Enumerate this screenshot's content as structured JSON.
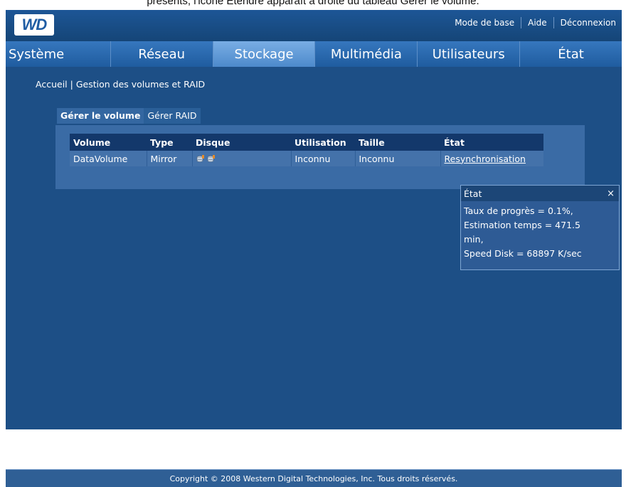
{
  "caption": "présents, l'icône Étendre apparaît à droite du tableau Gérer le volume.",
  "header": {
    "logo_text": "WD",
    "links": [
      "Mode de base",
      "Aide",
      "Déconnexion"
    ]
  },
  "nav": {
    "tabs": [
      "Système",
      "Réseau",
      "Stockage",
      "Multimédia",
      "Utilisateurs",
      "État"
    ],
    "active": "Stockage"
  },
  "breadcrumb": {
    "home": "Accueil",
    "separator": "|",
    "current": "Gestion des volumes et RAID"
  },
  "subtabs": {
    "manage_volume": "Gérer le volume",
    "manage_raid": "Gérer RAID"
  },
  "table": {
    "headers": {
      "volume": "Volume",
      "type": "Type",
      "disk": "Disque",
      "usage": "Utilisation",
      "size": "Taille",
      "status": "État"
    },
    "row": {
      "volume": "DataVolume",
      "type": "Mirror",
      "disk_icons": [
        "disk-1-icon",
        "disk-2-icon"
      ],
      "usage": "Inconnu",
      "size": "Inconnu",
      "status": "Resynchronisation"
    }
  },
  "popup": {
    "title": "État",
    "close": "×",
    "lines": [
      "Taux de progrès = 0.1%,",
      "Estimation temps = 471.5",
      "min,",
      "Speed Disk = 68897 K/sec"
    ]
  },
  "footer": {
    "text": "Copyright © 2008 Western Digital Technologies, Inc. Tous droits réservés."
  },
  "colors": {
    "background": "#1d4f86",
    "nav_active": "#6aa0da",
    "table_header": "#13386b",
    "table_row": "#4472aa"
  }
}
